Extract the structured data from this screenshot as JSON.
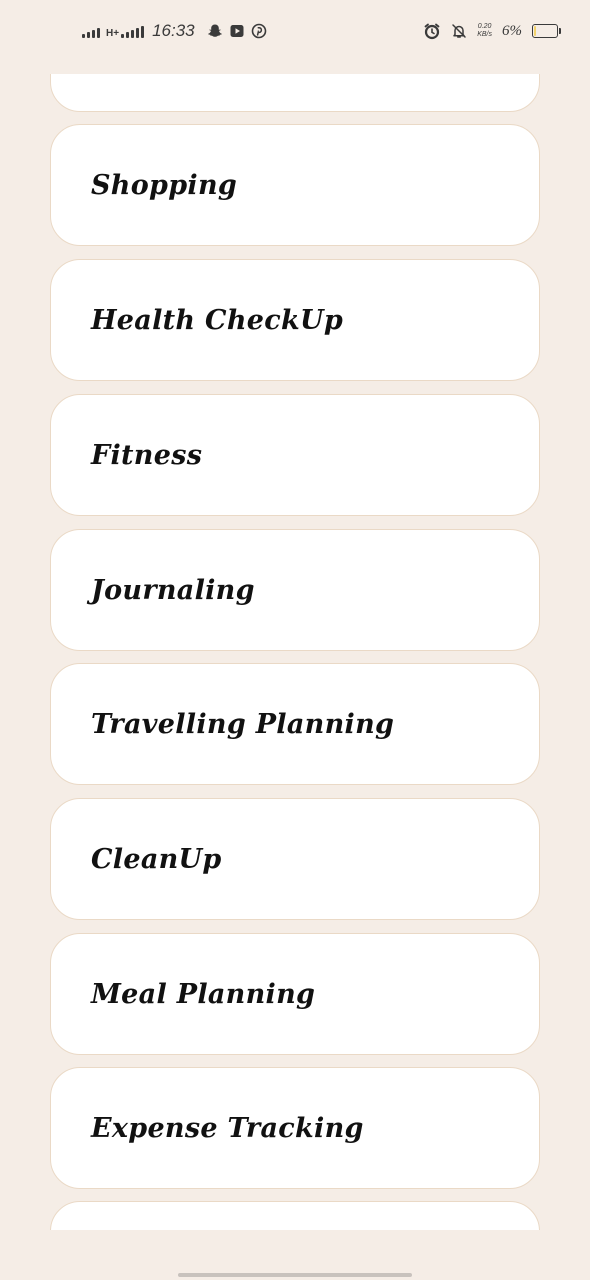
{
  "status_bar": {
    "network_type": "H+",
    "time": "16:33",
    "notification_icons": [
      "snapchat-icon",
      "youtube-icon",
      "pinterest-icon"
    ],
    "system_icons": [
      "alarm-icon",
      "notifications-off-icon"
    ],
    "net_speed_value": "0.20",
    "net_speed_unit": "KB/s",
    "battery_percent": "6%",
    "battery_level": 0.06,
    "battery_color": "#f3d36b"
  },
  "theme": {
    "background": "#f5ede6",
    "card_background": "#ffffff",
    "card_border": "#ead9c6",
    "text_color": "#111111"
  },
  "list": {
    "partial_top_item": "",
    "items": [
      {
        "label": "Shopping"
      },
      {
        "label": "Health CheckUp"
      },
      {
        "label": "Fitness"
      },
      {
        "label": "Journaling"
      },
      {
        "label": "Travelling Planning"
      },
      {
        "label": "CleanUp"
      },
      {
        "label": "Meal Planning"
      },
      {
        "label": "Expense Tracking"
      }
    ],
    "partial_bottom_item": ""
  }
}
